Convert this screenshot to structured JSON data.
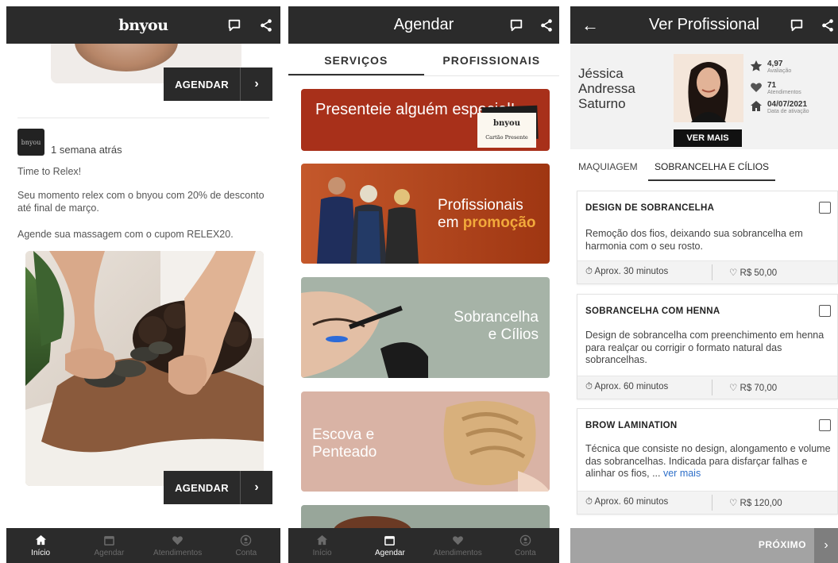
{
  "screen1": {
    "logo": "bnyou",
    "agendar_label": "AGENDAR",
    "post": {
      "brand": "bnyou",
      "time": "1 semana atrás",
      "title": "Time to Relex!",
      "body": "Seu momento relex com o bnyou com 20% de desconto até final de março.",
      "cta": "Agende sua massagem com o cupom RELEX20."
    }
  },
  "screen2": {
    "title": "Agendar",
    "tabs": [
      "SERVIÇOS",
      "PROFISSIONAIS"
    ],
    "banners": {
      "gift_text": "Presenteie alguém especial!",
      "gift_card_brand": "bnyou",
      "gift_card_label": "Cartão Presente",
      "promo_line1": "Profissionais",
      "promo_line2a": "em ",
      "promo_line2b": "promoção",
      "brows_line1": "Sobrancelha",
      "brows_line2": "e Cílios",
      "hair_line1": "Escova e",
      "hair_line2": "Penteado"
    }
  },
  "screen3": {
    "title": "Ver Profissional",
    "professional": {
      "name_line1": "Jéssica",
      "name_line2": "Andressa",
      "name_line3": "Saturno",
      "rating": "4,97",
      "rating_label": "Avaliação",
      "appointments": "71",
      "appointments_label": "Atendimentos",
      "activation_date": "04/07/2021",
      "activation_label": "Data de ativação",
      "ver_mais": "VER MAIS"
    },
    "tabs": [
      "MAQUIAGEM",
      "SOBRANCELHA E CÍLIOS"
    ],
    "services": [
      {
        "title": "DESIGN DE SOBRANCELHA",
        "desc": "Remoção dos fios, deixando sua sobrancelha em harmonia com o seu rosto.",
        "duration": "Aprox. 30 minutos",
        "price": "R$ 50,00"
      },
      {
        "title": "SOBRANCELHA COM HENNA",
        "desc": "Design de sobrancelha com preenchimento em henna para realçar ou corrigir o formato natural das sobrancelhas.",
        "duration": "Aprox. 60 minutos",
        "price": "R$ 70,00"
      },
      {
        "title": "BROW LAMINATION",
        "desc": "Técnica que consiste no design, alongamento e volume das sobrancelhas. Indicada para disfarçar falhas e alinhar os fios, ...",
        "more": "ver mais",
        "duration": "Aprox. 60 minutos",
        "price": "R$ 120,00"
      }
    ],
    "next_label": "PRÓXIMO"
  },
  "nav": {
    "items": [
      "Início",
      "Agendar",
      "Atendimentos",
      "Conta"
    ]
  },
  "colors": {
    "bar": "#2b2b2b",
    "gift_banner": "#a8301a",
    "promo_banner": "#b5461e",
    "promo_highlight": "#f2a93b",
    "brows_banner": "#a6b3a7",
    "hair_banner": "#d9b3a5",
    "link": "#2e6fc9"
  }
}
